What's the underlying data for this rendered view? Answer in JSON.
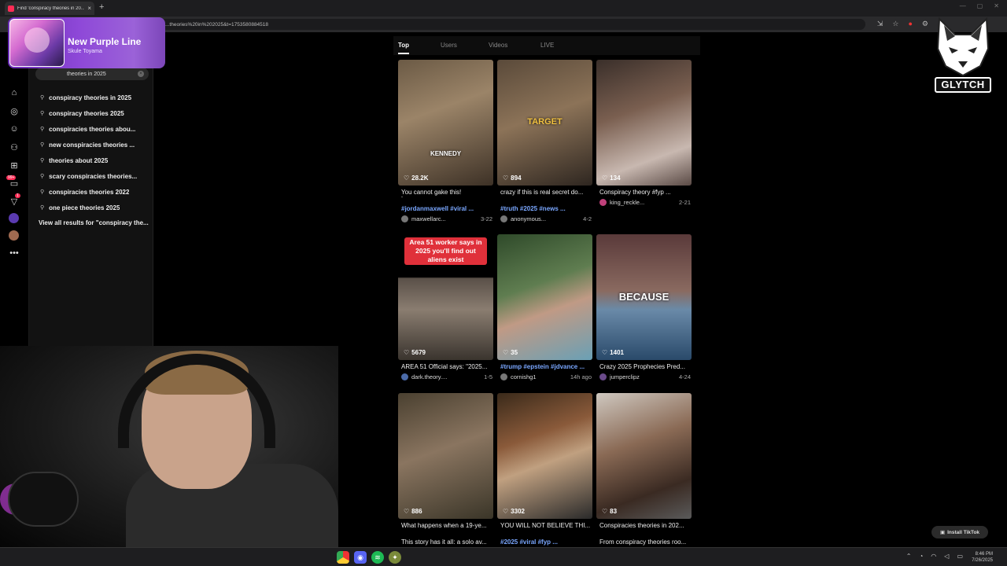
{
  "browser": {
    "tab_title": "Find 'conspiracy theories in 20...",
    "tab_close": "×",
    "new_tab": "+",
    "url": "...theories%20in%202025&t=1753580884518",
    "window_controls": [
      "—",
      "▢",
      "✕"
    ],
    "toolbar_icons": [
      "⇲",
      "☆",
      "●",
      "⚙"
    ]
  },
  "now_playing": {
    "title": "New Purple Line",
    "artist": "Skule Toyama"
  },
  "search": {
    "query": "theories in 2025",
    "clear": "×",
    "suggestions": [
      "conspiracy theories in 2025",
      "conspiracy theories 2025",
      "conspiracies theories abou...",
      "new conspiracies theories ...",
      "theories about 2025",
      "scary conspiracies theories...",
      "conspiracies theories 2022",
      "one piece theories 2025"
    ],
    "view_all": "View all results for \"conspiracy the..."
  },
  "rail": {
    "badge_messages": "99+",
    "badge_inbox": "1"
  },
  "result_tabs": [
    "Top",
    "Users",
    "Videos",
    "LIVE"
  ],
  "videos": [
    {
      "likes": "28.2K",
      "caption": "You cannot gake this!",
      "extra": "-",
      "tags": "#jordanmaxwell #viral ...",
      "user": "maxwellarc...",
      "date": "3-22",
      "overlay": "KENNEDY",
      "bg": "linear-gradient(160deg,#6b5a45 0%,#9b8468 40%,#3d3126 100%)"
    },
    {
      "likes": "894",
      "caption": "crazy if this is real secret do...",
      "extra": "",
      "tags": "#truth #2025 #news ...",
      "user": "anonymous...",
      "date": "4-2",
      "overlay": "TARGET",
      "bg": "linear-gradient(160deg,#5a4a3a 0%,#8c7358 45%,#2e2620 100%)"
    },
    {
      "likes": "134",
      "caption": "Conspiracy theory #fyp ...",
      "extra": "",
      "tags": "",
      "user": "king_reckle...",
      "date": "2-21",
      "overlay": "",
      "bg": "linear-gradient(160deg,#3a2f2a 0%,#7a5f50 40%,#c8b8b0 75%,#5a4a45 100%)"
    },
    {
      "likes": "5679",
      "caption": "AREA 51 Official says: \"2025...",
      "extra": "",
      "tags": "",
      "user": "dark.theory....",
      "date": "1-5",
      "overlay": "Area 51 worker says in 2025 you'll find out aliens exist",
      "bg": "linear-gradient(180deg,#000 0%,#000 34%,#5a5048 35%,#8a7d70 60%,#3a342e 100%)"
    },
    {
      "likes": "35",
      "caption": "#trump #epstein #jdvance ...",
      "extra": "",
      "tags": "",
      "user": "cornishg1",
      "date": "14h ago",
      "overlay": "",
      "bg": "linear-gradient(160deg,#2f4a2a 0%,#5f7d50 40%,#c09a85 60%,#6aa0b5 100%)"
    },
    {
      "likes": "1401",
      "caption": "Crazy 2025 Prophecies Pred...",
      "extra": "",
      "tags": "",
      "user": "jumperclipz",
      "date": "4-24",
      "overlay": "BECAUSE",
      "bg": "linear-gradient(180deg,#5a3a3a 0%,#8a6a60 45%,#6a8aa8 60%,#2a4a6a 100%)"
    },
    {
      "likes": "886",
      "caption": "What happens when a 19-ye...",
      "extra": "This story has it all: a solo av...",
      "tags": "",
      "user": "",
      "date": "",
      "overlay": "",
      "bg": "linear-gradient(160deg,#4a4030 0%,#8a7560 45%,#3a3528 100%)"
    },
    {
      "likes": "3302",
      "caption": "YOU WILL NOT BELIEVE THI...",
      "extra": "",
      "tags": "#2025 #viral #fyp ...",
      "user": "",
      "date": "",
      "overlay": "",
      "bg": "linear-gradient(160deg,#3a2a1a 0%,#8a5a3a 35%,#c0a080 55%,#2a2a2a 100%)"
    },
    {
      "likes": "83",
      "caption": "Conspiracies theories in 202...",
      "extra": "From conspiracy theories roo...",
      "tags": "",
      "user": "",
      "date": "",
      "overlay": "",
      "bg": "linear-gradient(160deg,#cfc8c0 0%,#8a6a55 40%,#3a2a22 75%,#5a5a5a 100%)"
    }
  ],
  "logo_text": "GLYTCH",
  "install": "Install TikTok",
  "clock": {
    "time": "8:46 PM",
    "date": "7/26/2025"
  }
}
